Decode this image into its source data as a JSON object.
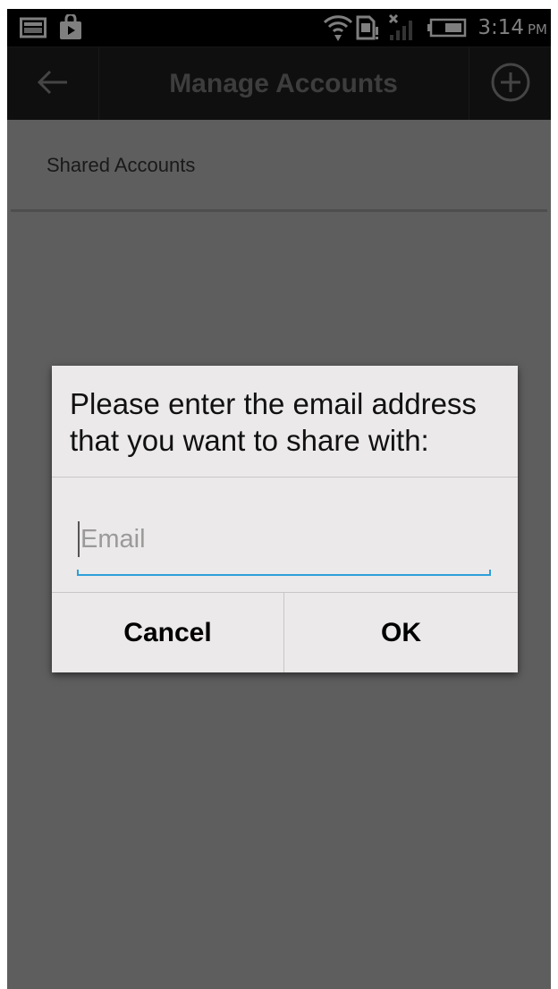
{
  "status_bar": {
    "time": "3:14",
    "ampm": "PM",
    "icons": [
      "gallery-icon",
      "shopping-bag-icon",
      "wifi-icon",
      "sim-card-icon",
      "no-signal-icon",
      "battery-icon"
    ]
  },
  "action_bar": {
    "title": "Manage Accounts",
    "back_icon": "arrow-left-icon",
    "add_icon": "plus-circle-icon"
  },
  "content": {
    "list_header": "Shared Accounts"
  },
  "dialog": {
    "message": "Please enter the email address that you want to share with:",
    "email_input": {
      "value": "",
      "placeholder": "Email"
    },
    "cancel_label": "Cancel",
    "ok_label": "OK",
    "accent_color": "#2e9fd9"
  }
}
